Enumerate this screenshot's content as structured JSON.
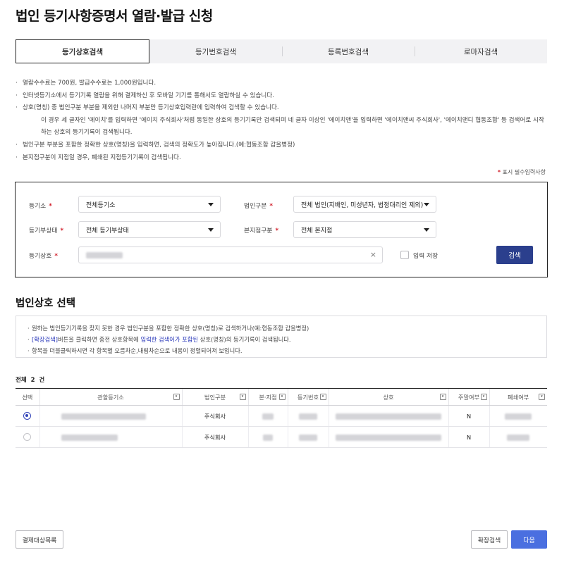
{
  "page": {
    "title": "법인 등기사항증명서 열람·발급 신청"
  },
  "tabs": [
    {
      "label": "등기상호검색",
      "active": true
    },
    {
      "label": "등기번호검색",
      "active": false
    },
    {
      "label": "등록번호검색",
      "active": false
    },
    {
      "label": "로마자검색",
      "active": false
    }
  ],
  "notices": [
    "열람수수료는 700원, 발급수수료는 1,000원입니다.",
    "인터넷등기소에서 등기기록 열람을 위해 결제하신 후 모바일 기기를 통해서도 열람하실 수 있습니다.",
    "상호(명칭) 중 법인구분 부분을 제외한 나머지 부분만 등기상호입력란에 입력하여 검색할 수 있습니다.",
    "이 경우 세 글자인 '에이치'를 입력하면 '에이치 주식회사'처럼 동일한 상호의 등기기록만 검색되며 네 글자 이상인 '에이치앤'을 입력하면 '에이치앤씨 주식회사', '에이치앤디 협동조합' 등 검색어로 시작",
    "하는 상호의 등기기록이 검색됩니다.",
    "법인구분 부분을 포함한 정확한 상호(명칭)을 입력하면, 검색의 정확도가 높아집니다.(예:협동조합 갑을병정)",
    "본지점구분이 지점일 경우, 폐쇄된 지점등기기록이 검색됩니다."
  ],
  "required_note": {
    "star": "*",
    "text": "표시 필수입력사항"
  },
  "search_form": {
    "registry_office": {
      "label": "등기소",
      "star": "*",
      "value": "전체등기소"
    },
    "corp_type": {
      "label": "법인구분",
      "star": "*",
      "value": "전체 법인(지배인, 미성년자, 법정대리인 제외)"
    },
    "reg_status": {
      "label": "등기부상태",
      "star": "*",
      "value": "전체 등기부상태"
    },
    "branch_type": {
      "label": "본지점구분",
      "star": "*",
      "value": "전체 본지점"
    },
    "corp_name": {
      "label": "등기상호",
      "star": "*",
      "clear": "×"
    },
    "save_input_label": "입력 저장",
    "search_button": "검색"
  },
  "section": {
    "title": "법인상호 선택"
  },
  "info": {
    "line1": "원하는 법인등기기록을 찾지 못한 경우 법인구분을 포함한 정확한 상호(명칭)로 검색하거나(예:협동조합 갑을병정)",
    "line2_a": "[확장검색]",
    "line2_b": "버튼을 클릭하면 종전 상호항목에 ",
    "line2_c": "입력한 검색어가 포함된",
    "line2_d": " 상호(명칭)의 등기기록이 검색됩니다.",
    "line3": "항목을 더블클릭하시면 각 항목별 오름차순,내림차순으로 내용이 정렬되어져 보입니다."
  },
  "results": {
    "total_label": "전체",
    "total_count": "2",
    "total_unit": "건",
    "columns": [
      "선택",
      "관할등기소",
      "법인구분",
      "본·지점",
      "등기번호",
      "상호",
      "주말여부",
      "폐쇄여부"
    ],
    "sort_glyph": "▾",
    "rows": [
      {
        "selected": true,
        "corp_type": "주식회사",
        "weekend": "N"
      },
      {
        "selected": false,
        "corp_type": "주식회사",
        "weekend": "N"
      }
    ]
  },
  "footer": {
    "payment_list_button": "결제대상목록",
    "extended_search_button": "확장검색",
    "next_button": "다음"
  }
}
